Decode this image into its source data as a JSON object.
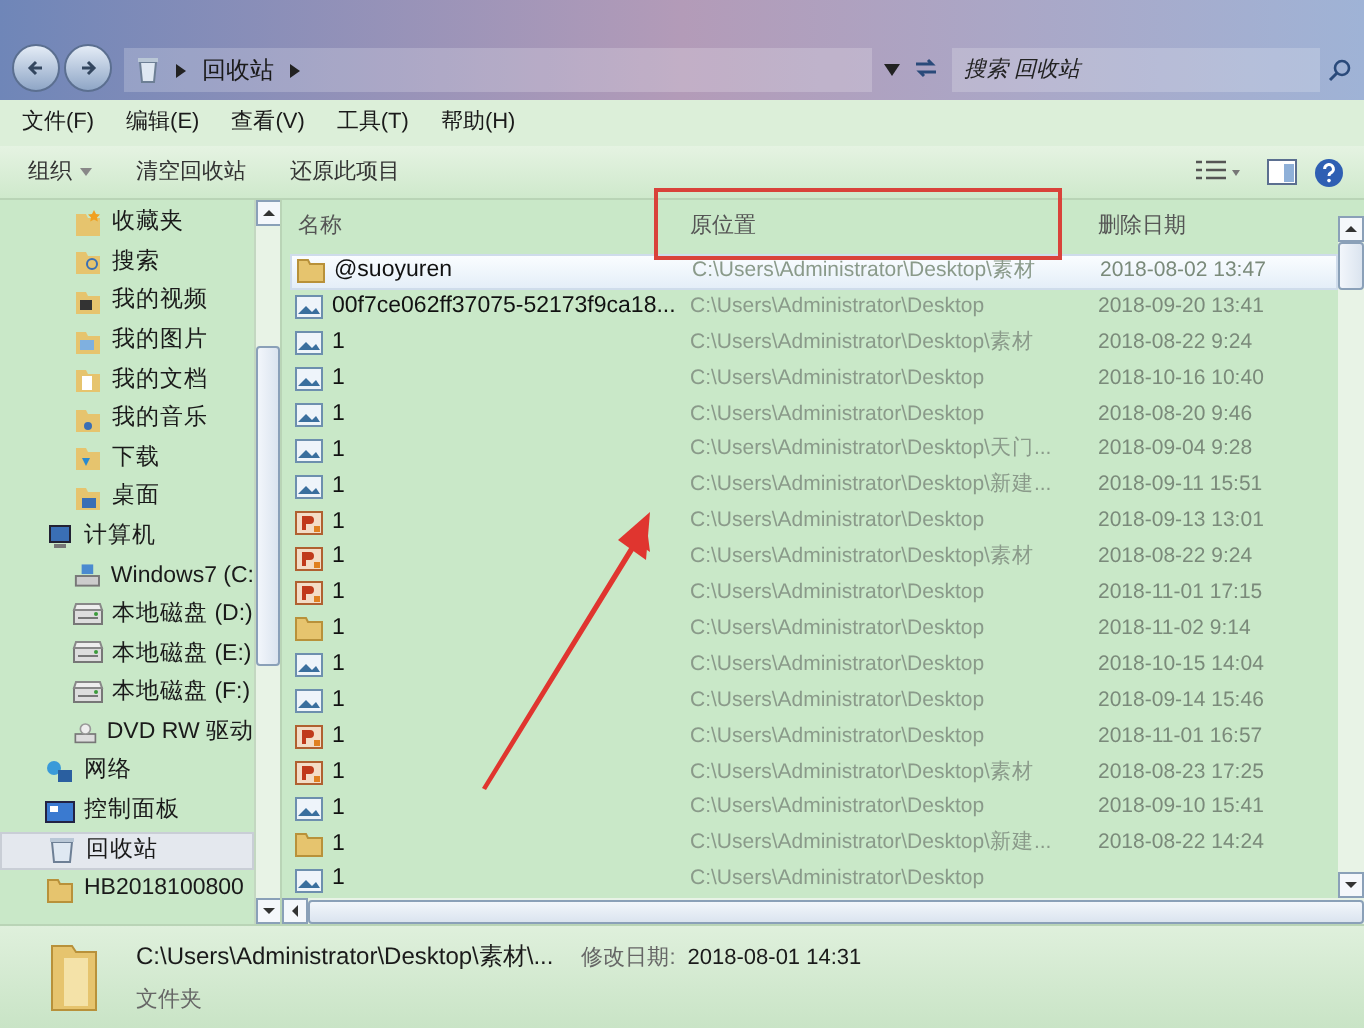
{
  "address_bar": {
    "segments": [
      "回收站"
    ]
  },
  "search": {
    "placeholder": "搜索 回收站"
  },
  "menu": [
    "文件(F)",
    "编辑(E)",
    "查看(V)",
    "工具(T)",
    "帮助(H)"
  ],
  "toolbar": [
    {
      "label": "组织",
      "kind": "dropdown"
    },
    {
      "label": "清空回收站",
      "kind": "plain"
    },
    {
      "label": "还原此项目",
      "kind": "plain"
    }
  ],
  "sidebar": {
    "items": [
      {
        "label": "收藏夹",
        "kind": "star",
        "selected": false
      },
      {
        "label": "搜索",
        "kind": "search",
        "selected": false
      },
      {
        "label": "我的视频",
        "kind": "video",
        "selected": false
      },
      {
        "label": "我的图片",
        "kind": "picture",
        "selected": false
      },
      {
        "label": "我的文档",
        "kind": "document",
        "selected": false
      },
      {
        "label": "我的音乐",
        "kind": "music",
        "selected": false
      },
      {
        "label": "下载",
        "kind": "download",
        "selected": false
      },
      {
        "label": "桌面",
        "kind": "desktop",
        "selected": false
      },
      {
        "label": "计算机",
        "kind": "computer",
        "selected": false,
        "children": [
          {
            "label": "Windows7 (C:",
            "kind": "system-drive",
            "selected": false
          },
          {
            "label": "本地磁盘 (D:)",
            "kind": "drive",
            "selected": false
          },
          {
            "label": "本地磁盘 (E:)",
            "kind": "drive",
            "selected": false
          },
          {
            "label": "本地磁盘 (F:)",
            "kind": "drive",
            "selected": false
          },
          {
            "label": "DVD RW 驱动",
            "kind": "dvd",
            "selected": false
          }
        ]
      },
      {
        "label": "网络",
        "kind": "network",
        "selected": false
      },
      {
        "label": "控制面板",
        "kind": "control-panel",
        "selected": false
      },
      {
        "label": "回收站",
        "kind": "recycle-bin",
        "selected": true
      },
      {
        "label": "HB2018100800",
        "kind": "folder",
        "selected": false
      }
    ]
  },
  "table": {
    "columns": [
      "名称",
      "原位置",
      "删除日期"
    ],
    "rows": [
      {
        "kind": "folder",
        "selected": true,
        "name": "@suoyuren",
        "location": "C:\\Users\\Administrator\\Desktop\\素材",
        "date": "2018-08-02 13:47"
      },
      {
        "kind": "image",
        "selected": false,
        "name": "00f7ce062ff37075-52173f9ca18...",
        "location": "C:\\Users\\Administrator\\Desktop",
        "date": "2018-09-20 13:41"
      },
      {
        "kind": "image",
        "selected": false,
        "name": "1",
        "location": "C:\\Users\\Administrator\\Desktop\\素材",
        "date": "2018-08-22 9:24"
      },
      {
        "kind": "image",
        "selected": false,
        "name": "1",
        "location": "C:\\Users\\Administrator\\Desktop",
        "date": "2018-10-16 10:40"
      },
      {
        "kind": "image",
        "selected": false,
        "name": "1",
        "location": "C:\\Users\\Administrator\\Desktop",
        "date": "2018-08-20 9:46"
      },
      {
        "kind": "image",
        "selected": false,
        "name": "1",
        "location": "C:\\Users\\Administrator\\Desktop\\天门...",
        "date": "2018-09-04 9:28"
      },
      {
        "kind": "image",
        "selected": false,
        "name": "1",
        "location": "C:\\Users\\Administrator\\Desktop\\新建...",
        "date": "2018-09-11 15:51"
      },
      {
        "kind": "slides",
        "selected": false,
        "name": "1",
        "location": "C:\\Users\\Administrator\\Desktop",
        "date": "2018-09-13 13:01"
      },
      {
        "kind": "slides",
        "selected": false,
        "name": "1",
        "location": "C:\\Users\\Administrator\\Desktop\\素材",
        "date": "2018-08-22 9:24"
      },
      {
        "kind": "slides",
        "selected": false,
        "name": "1",
        "location": "C:\\Users\\Administrator\\Desktop",
        "date": "2018-11-01 17:15"
      },
      {
        "kind": "folder",
        "selected": false,
        "name": "1",
        "location": "C:\\Users\\Administrator\\Desktop",
        "date": "2018-11-02 9:14"
      },
      {
        "kind": "image",
        "selected": false,
        "name": "1",
        "location": "C:\\Users\\Administrator\\Desktop",
        "date": "2018-10-15 14:04"
      },
      {
        "kind": "image",
        "selected": false,
        "name": "1",
        "location": "C:\\Users\\Administrator\\Desktop",
        "date": "2018-09-14 15:46"
      },
      {
        "kind": "slides",
        "selected": false,
        "name": "1",
        "location": "C:\\Users\\Administrator\\Desktop",
        "date": "2018-11-01 16:57"
      },
      {
        "kind": "slides",
        "selected": false,
        "name": "1",
        "location": "C:\\Users\\Administrator\\Desktop\\素材",
        "date": "2018-08-23 17:25"
      },
      {
        "kind": "image",
        "selected": false,
        "name": "1",
        "location": "C:\\Users\\Administrator\\Desktop",
        "date": "2018-09-10 15:41"
      },
      {
        "kind": "folder",
        "selected": false,
        "name": "1",
        "location": "C:\\Users\\Administrator\\Desktop\\新建...",
        "date": "2018-08-22 14:24"
      },
      {
        "kind": "image",
        "selected": false,
        "name": "1",
        "location": "C:\\Users\\Administrator\\Desktop"
      }
    ]
  },
  "details": {
    "path": "C:\\Users\\Administrator\\Desktop\\素材\\...",
    "modified_label": "修改日期:",
    "modified": "2018-08-01 14:31",
    "type": "文件夹"
  }
}
